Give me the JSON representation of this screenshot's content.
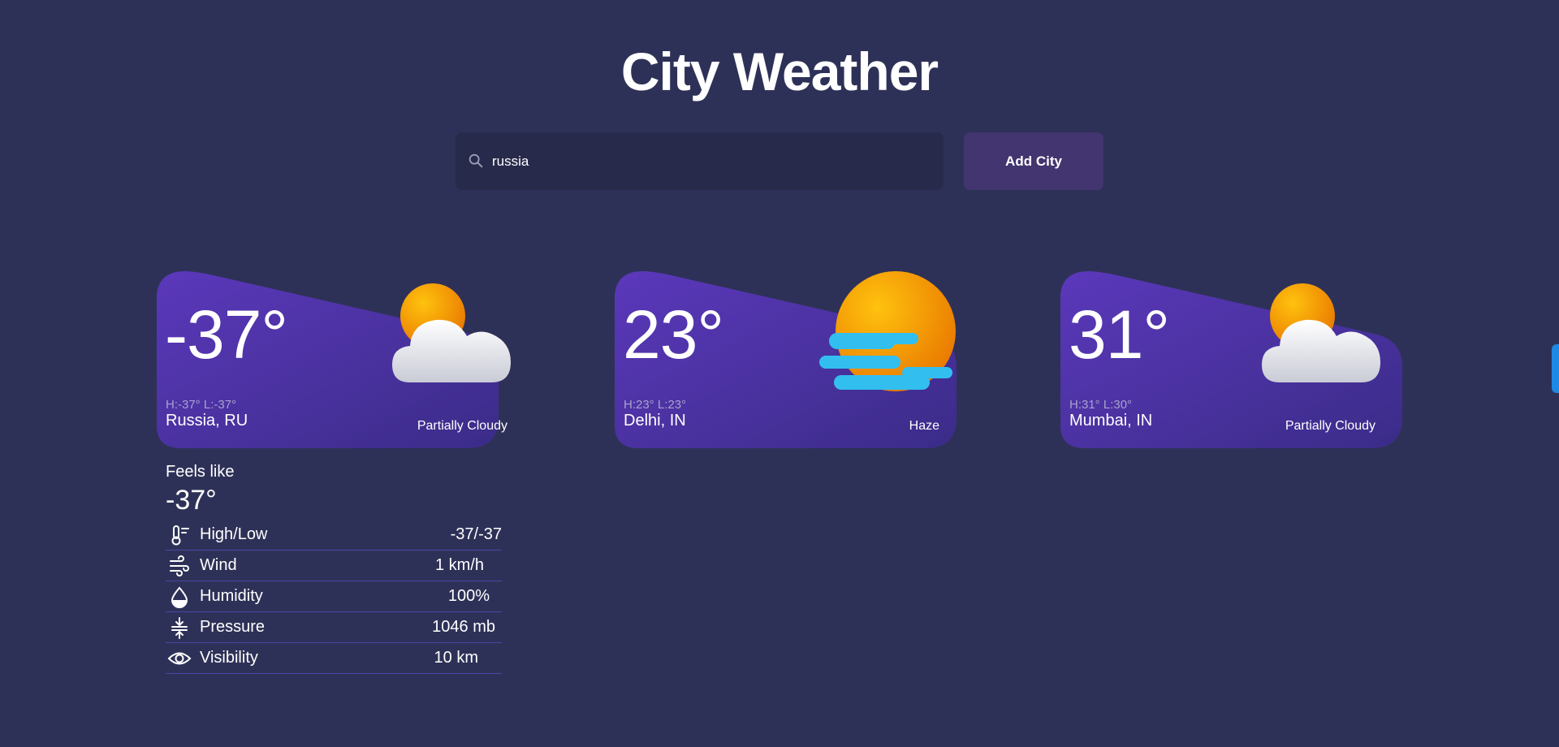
{
  "app": {
    "title": "City Weather"
  },
  "search": {
    "value": "russia",
    "button_label": "Add City"
  },
  "cards": [
    {
      "temp": "-37°",
      "hl": "H:-37° L:-37°",
      "city": "Russia, RU",
      "condition": "Partially Cloudy",
      "icon": "partly-cloudy-icon"
    },
    {
      "temp": "23°",
      "hl": "H:23° L:23°",
      "city": "Delhi, IN",
      "condition": "Haze",
      "icon": "haze-icon"
    },
    {
      "temp": "31°",
      "hl": "H:31° L:30°",
      "city": "Mumbai, IN",
      "condition": "Partially Cloudy",
      "icon": "partly-cloudy-icon"
    }
  ],
  "details": {
    "feels_label": "Feels like",
    "feels_value": "-37°",
    "rows": [
      {
        "label": "High/Low",
        "value": "-37/-37",
        "icon": "thermometer-icon"
      },
      {
        "label": "Wind",
        "value": "1 km/h",
        "icon": "wind-icon"
      },
      {
        "label": "Humidity",
        "value": "100%",
        "icon": "humidity-icon"
      },
      {
        "label": "Pressure",
        "value": "1046 mb",
        "icon": "pressure-icon"
      },
      {
        "label": "Visibility",
        "value": "10 km",
        "icon": "eye-icon"
      }
    ]
  },
  "colors": {
    "background": "#2e3157",
    "card_gradient_start": "#5b3bb8",
    "card_gradient_end": "#3f2f8c",
    "accent_button": "#43356f",
    "divider": "#4a45a6"
  }
}
